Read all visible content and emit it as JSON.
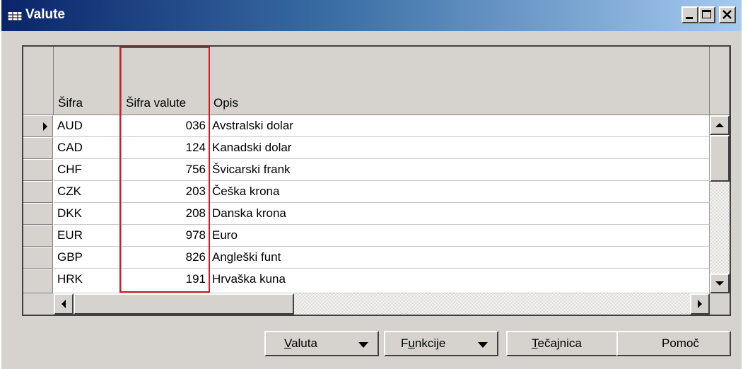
{
  "window": {
    "title": "Valute",
    "controls": [
      "minimize-icon",
      "maximize-icon",
      "close-icon"
    ]
  },
  "table": {
    "columns": [
      "Šifra",
      "Šifra valute",
      "Opis"
    ],
    "rows": [
      {
        "code": "AUD",
        "num": "036",
        "desc": "Avstralski dolar",
        "current": true
      },
      {
        "code": "CAD",
        "num": "124",
        "desc": "Kanadski dolar"
      },
      {
        "code": "CHF",
        "num": "756",
        "desc": "Švicarski frank"
      },
      {
        "code": "CZK",
        "num": "203",
        "desc": "Češka krona"
      },
      {
        "code": "DKK",
        "num": "208",
        "desc": "Danska krona"
      },
      {
        "code": "EUR",
        "num": "978",
        "desc": "Euro"
      },
      {
        "code": "GBP",
        "num": "826",
        "desc": "Angleški funt"
      },
      {
        "code": "HRK",
        "num": "191",
        "desc": "Hrvaška kuna"
      }
    ],
    "highlight_color": "#e0141e"
  },
  "buttons": {
    "valuta": {
      "pre": "",
      "u": "V",
      "post": "aluta"
    },
    "funkcije": {
      "pre": "F",
      "u": "u",
      "post": "nkcije"
    },
    "tecajnica": {
      "pre": "",
      "u": "T",
      "post": "ečajnica"
    },
    "pomoc": "Pomoč"
  }
}
